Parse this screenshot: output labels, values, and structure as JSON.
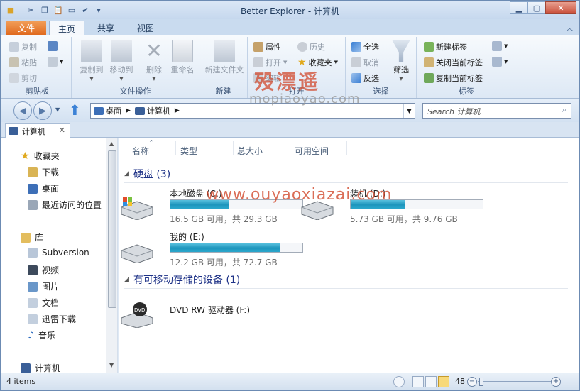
{
  "window": {
    "title": "Better Explorer - 计算机"
  },
  "tabs": {
    "file": "文件",
    "home": "主页",
    "share": "共享",
    "view": "视图"
  },
  "ribbon": {
    "clipboard": {
      "copy": "复制",
      "paste": "粘贴",
      "cut": "剪切",
      "label": "剪贴板"
    },
    "file_ops": {
      "copy_to": "复制到",
      "move_to": "移动到",
      "delete": "删除",
      "rename": "重命名",
      "label": "文件操作"
    },
    "new": {
      "new_folder": "新建文件夹",
      "label": "新建"
    },
    "open": {
      "properties": "属性",
      "history": "历史",
      "open": "打开",
      "favorites": "收藏夹",
      "edit": "编辑",
      "label": "打开"
    },
    "select": {
      "select_all": "全选",
      "select_none": "取消",
      "invert": "反选",
      "filter": "筛选",
      "label": "选择"
    },
    "tabs_group": {
      "new_tab": "新建标签",
      "close_current": "关闭当前标签",
      "copy_current": "复制当前标签",
      "label": "标签"
    }
  },
  "nav": {
    "breadcrumb": [
      "桌面",
      "计算机"
    ],
    "search_placeholder": "Search 计算机"
  },
  "doc_tab": {
    "label": "计算机"
  },
  "nav_pane": {
    "favorites": {
      "label": "收藏夹",
      "items": [
        "下载",
        "桌面",
        "最近访问的位置"
      ]
    },
    "libraries": {
      "label": "库",
      "items": [
        "Subversion",
        "视频",
        "图片",
        "文档",
        "迅雷下载",
        "音乐"
      ]
    },
    "computer": "计算机"
  },
  "columns": [
    "名称",
    "类型",
    "总大小",
    "可用空间"
  ],
  "groups": {
    "hdd": {
      "title": "硬盘 (3)"
    },
    "removable": {
      "title": "有可移动存储的设备 (1)"
    }
  },
  "drives": [
    {
      "name": "本地磁盘 (C:)",
      "size": "16.5 GB 可用，共 29.3 GB",
      "used_fraction": 0.44
    },
    {
      "name": "装机 (D:)",
      "size": "5.73 GB 可用，共 9.76 GB",
      "used_fraction": 0.41
    },
    {
      "name": "我的 (E:)",
      "size": "12.2 GB 可用，共 72.7 GB",
      "used_fraction": 0.83
    }
  ],
  "removable": [
    {
      "name": "DVD RW 驱动器 (F:)"
    }
  ],
  "watermarks": {
    "logo": "殁漂遥",
    "url1": "mopiaoyao.com",
    "url2": "www.ouyaoxiazai.com"
  },
  "status": {
    "items": "4 items",
    "zoom": "48"
  },
  "colors": {
    "accent": "#1e3287",
    "file_tab": "#e06a1e",
    "bar_fill": "#1d95bc"
  }
}
